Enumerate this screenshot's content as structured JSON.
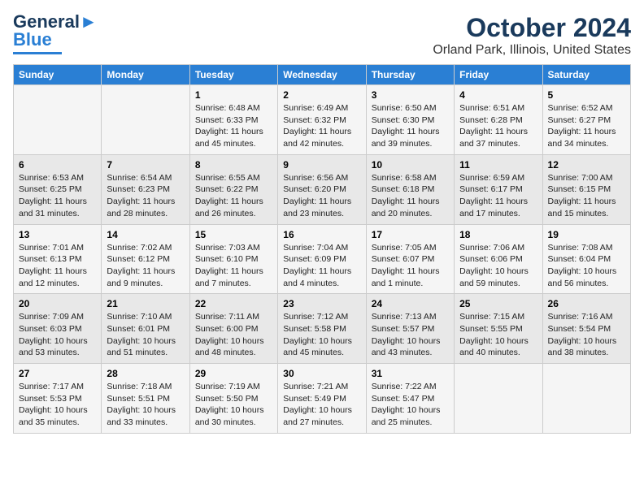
{
  "logo": {
    "line1": "General",
    "line2": "Blue"
  },
  "title": "October 2024",
  "subtitle": "Orland Park, Illinois, United States",
  "days_of_week": [
    "Sunday",
    "Monday",
    "Tuesday",
    "Wednesday",
    "Thursday",
    "Friday",
    "Saturday"
  ],
  "weeks": [
    [
      {
        "day": "",
        "info": ""
      },
      {
        "day": "",
        "info": ""
      },
      {
        "day": "1",
        "info": "Sunrise: 6:48 AM\nSunset: 6:33 PM\nDaylight: 11 hours and 45 minutes."
      },
      {
        "day": "2",
        "info": "Sunrise: 6:49 AM\nSunset: 6:32 PM\nDaylight: 11 hours and 42 minutes."
      },
      {
        "day": "3",
        "info": "Sunrise: 6:50 AM\nSunset: 6:30 PM\nDaylight: 11 hours and 39 minutes."
      },
      {
        "day": "4",
        "info": "Sunrise: 6:51 AM\nSunset: 6:28 PM\nDaylight: 11 hours and 37 minutes."
      },
      {
        "day": "5",
        "info": "Sunrise: 6:52 AM\nSunset: 6:27 PM\nDaylight: 11 hours and 34 minutes."
      }
    ],
    [
      {
        "day": "6",
        "info": "Sunrise: 6:53 AM\nSunset: 6:25 PM\nDaylight: 11 hours and 31 minutes."
      },
      {
        "day": "7",
        "info": "Sunrise: 6:54 AM\nSunset: 6:23 PM\nDaylight: 11 hours and 28 minutes."
      },
      {
        "day": "8",
        "info": "Sunrise: 6:55 AM\nSunset: 6:22 PM\nDaylight: 11 hours and 26 minutes."
      },
      {
        "day": "9",
        "info": "Sunrise: 6:56 AM\nSunset: 6:20 PM\nDaylight: 11 hours and 23 minutes."
      },
      {
        "day": "10",
        "info": "Sunrise: 6:58 AM\nSunset: 6:18 PM\nDaylight: 11 hours and 20 minutes."
      },
      {
        "day": "11",
        "info": "Sunrise: 6:59 AM\nSunset: 6:17 PM\nDaylight: 11 hours and 17 minutes."
      },
      {
        "day": "12",
        "info": "Sunrise: 7:00 AM\nSunset: 6:15 PM\nDaylight: 11 hours and 15 minutes."
      }
    ],
    [
      {
        "day": "13",
        "info": "Sunrise: 7:01 AM\nSunset: 6:13 PM\nDaylight: 11 hours and 12 minutes."
      },
      {
        "day": "14",
        "info": "Sunrise: 7:02 AM\nSunset: 6:12 PM\nDaylight: 11 hours and 9 minutes."
      },
      {
        "day": "15",
        "info": "Sunrise: 7:03 AM\nSunset: 6:10 PM\nDaylight: 11 hours and 7 minutes."
      },
      {
        "day": "16",
        "info": "Sunrise: 7:04 AM\nSunset: 6:09 PM\nDaylight: 11 hours and 4 minutes."
      },
      {
        "day": "17",
        "info": "Sunrise: 7:05 AM\nSunset: 6:07 PM\nDaylight: 11 hours and 1 minute."
      },
      {
        "day": "18",
        "info": "Sunrise: 7:06 AM\nSunset: 6:06 PM\nDaylight: 10 hours and 59 minutes."
      },
      {
        "day": "19",
        "info": "Sunrise: 7:08 AM\nSunset: 6:04 PM\nDaylight: 10 hours and 56 minutes."
      }
    ],
    [
      {
        "day": "20",
        "info": "Sunrise: 7:09 AM\nSunset: 6:03 PM\nDaylight: 10 hours and 53 minutes."
      },
      {
        "day": "21",
        "info": "Sunrise: 7:10 AM\nSunset: 6:01 PM\nDaylight: 10 hours and 51 minutes."
      },
      {
        "day": "22",
        "info": "Sunrise: 7:11 AM\nSunset: 6:00 PM\nDaylight: 10 hours and 48 minutes."
      },
      {
        "day": "23",
        "info": "Sunrise: 7:12 AM\nSunset: 5:58 PM\nDaylight: 10 hours and 45 minutes."
      },
      {
        "day": "24",
        "info": "Sunrise: 7:13 AM\nSunset: 5:57 PM\nDaylight: 10 hours and 43 minutes."
      },
      {
        "day": "25",
        "info": "Sunrise: 7:15 AM\nSunset: 5:55 PM\nDaylight: 10 hours and 40 minutes."
      },
      {
        "day": "26",
        "info": "Sunrise: 7:16 AM\nSunset: 5:54 PM\nDaylight: 10 hours and 38 minutes."
      }
    ],
    [
      {
        "day": "27",
        "info": "Sunrise: 7:17 AM\nSunset: 5:53 PM\nDaylight: 10 hours and 35 minutes."
      },
      {
        "day": "28",
        "info": "Sunrise: 7:18 AM\nSunset: 5:51 PM\nDaylight: 10 hours and 33 minutes."
      },
      {
        "day": "29",
        "info": "Sunrise: 7:19 AM\nSunset: 5:50 PM\nDaylight: 10 hours and 30 minutes."
      },
      {
        "day": "30",
        "info": "Sunrise: 7:21 AM\nSunset: 5:49 PM\nDaylight: 10 hours and 27 minutes."
      },
      {
        "day": "31",
        "info": "Sunrise: 7:22 AM\nSunset: 5:47 PM\nDaylight: 10 hours and 25 minutes."
      },
      {
        "day": "",
        "info": ""
      },
      {
        "day": "",
        "info": ""
      }
    ]
  ]
}
